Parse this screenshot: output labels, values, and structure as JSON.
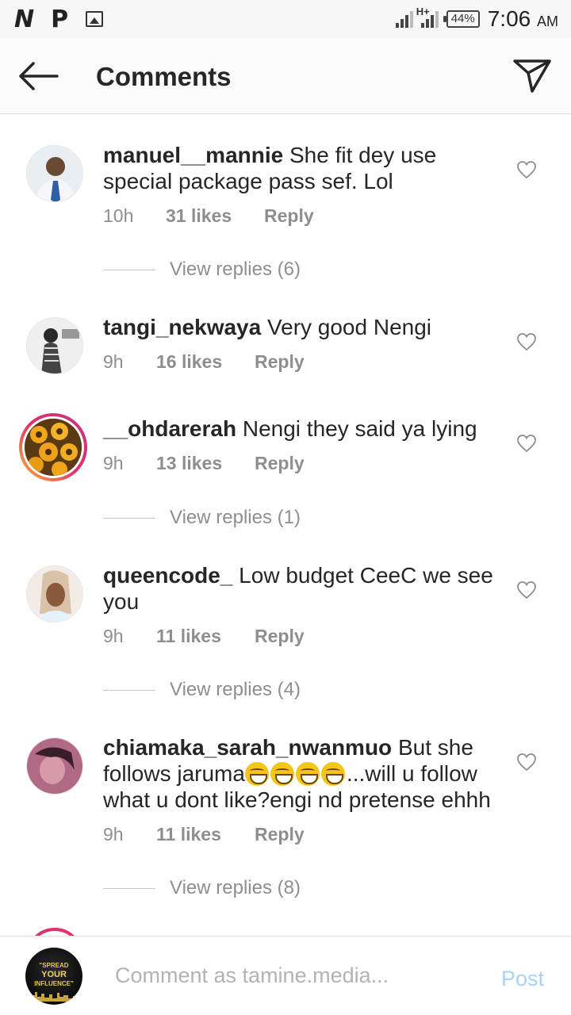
{
  "status_bar": {
    "left_icons": [
      "N",
      "P",
      "image-icon"
    ],
    "network": "H+",
    "battery": "44%",
    "time": "7:06",
    "ampm": "AM"
  },
  "header": {
    "title": "Comments"
  },
  "comments": [
    {
      "username": "manuel__mannie",
      "text": "She fit dey use special package pass sef. Lol",
      "time": "10h",
      "likes": "31 likes",
      "reply": "Reply",
      "view_replies": "View replies (6)"
    },
    {
      "username": "tangi_nekwaya",
      "text": "Very good Nengi",
      "time": "9h",
      "likes": "16 likes",
      "reply": "Reply"
    },
    {
      "username": "__ohdarerah",
      "text": "Nengi they said ya lying",
      "time": "9h",
      "likes": "13 likes",
      "reply": "Reply",
      "view_replies": "View replies (1)"
    },
    {
      "username": "queencode_",
      "text": "Low budget CeeC we see you",
      "time": "9h",
      "likes": "11 likes",
      "reply": "Reply",
      "view_replies": "View replies (4)"
    },
    {
      "username": "chiamaka_sarah_nwanmuo",
      "text_before_emoji": "But she follows jaruma",
      "emoji_count": 4,
      "text_after_emoji": "...will u follow what u dont like?engi nd pretense ehhh",
      "time": "9h",
      "likes": "11 likes",
      "reply": "Reply",
      "view_replies": "View replies (8)"
    }
  ],
  "comment_bar": {
    "avatar_text": [
      "\"SPREAD",
      "YOUR",
      "INFLUENCE\""
    ],
    "placeholder": "Comment as tamine.media...",
    "post_label": "Post"
  },
  "colors": {
    "accent_post_disabled": "#a9d2f7",
    "meta_gray": "#8e8e8e",
    "story_ring": "#e1306c"
  }
}
